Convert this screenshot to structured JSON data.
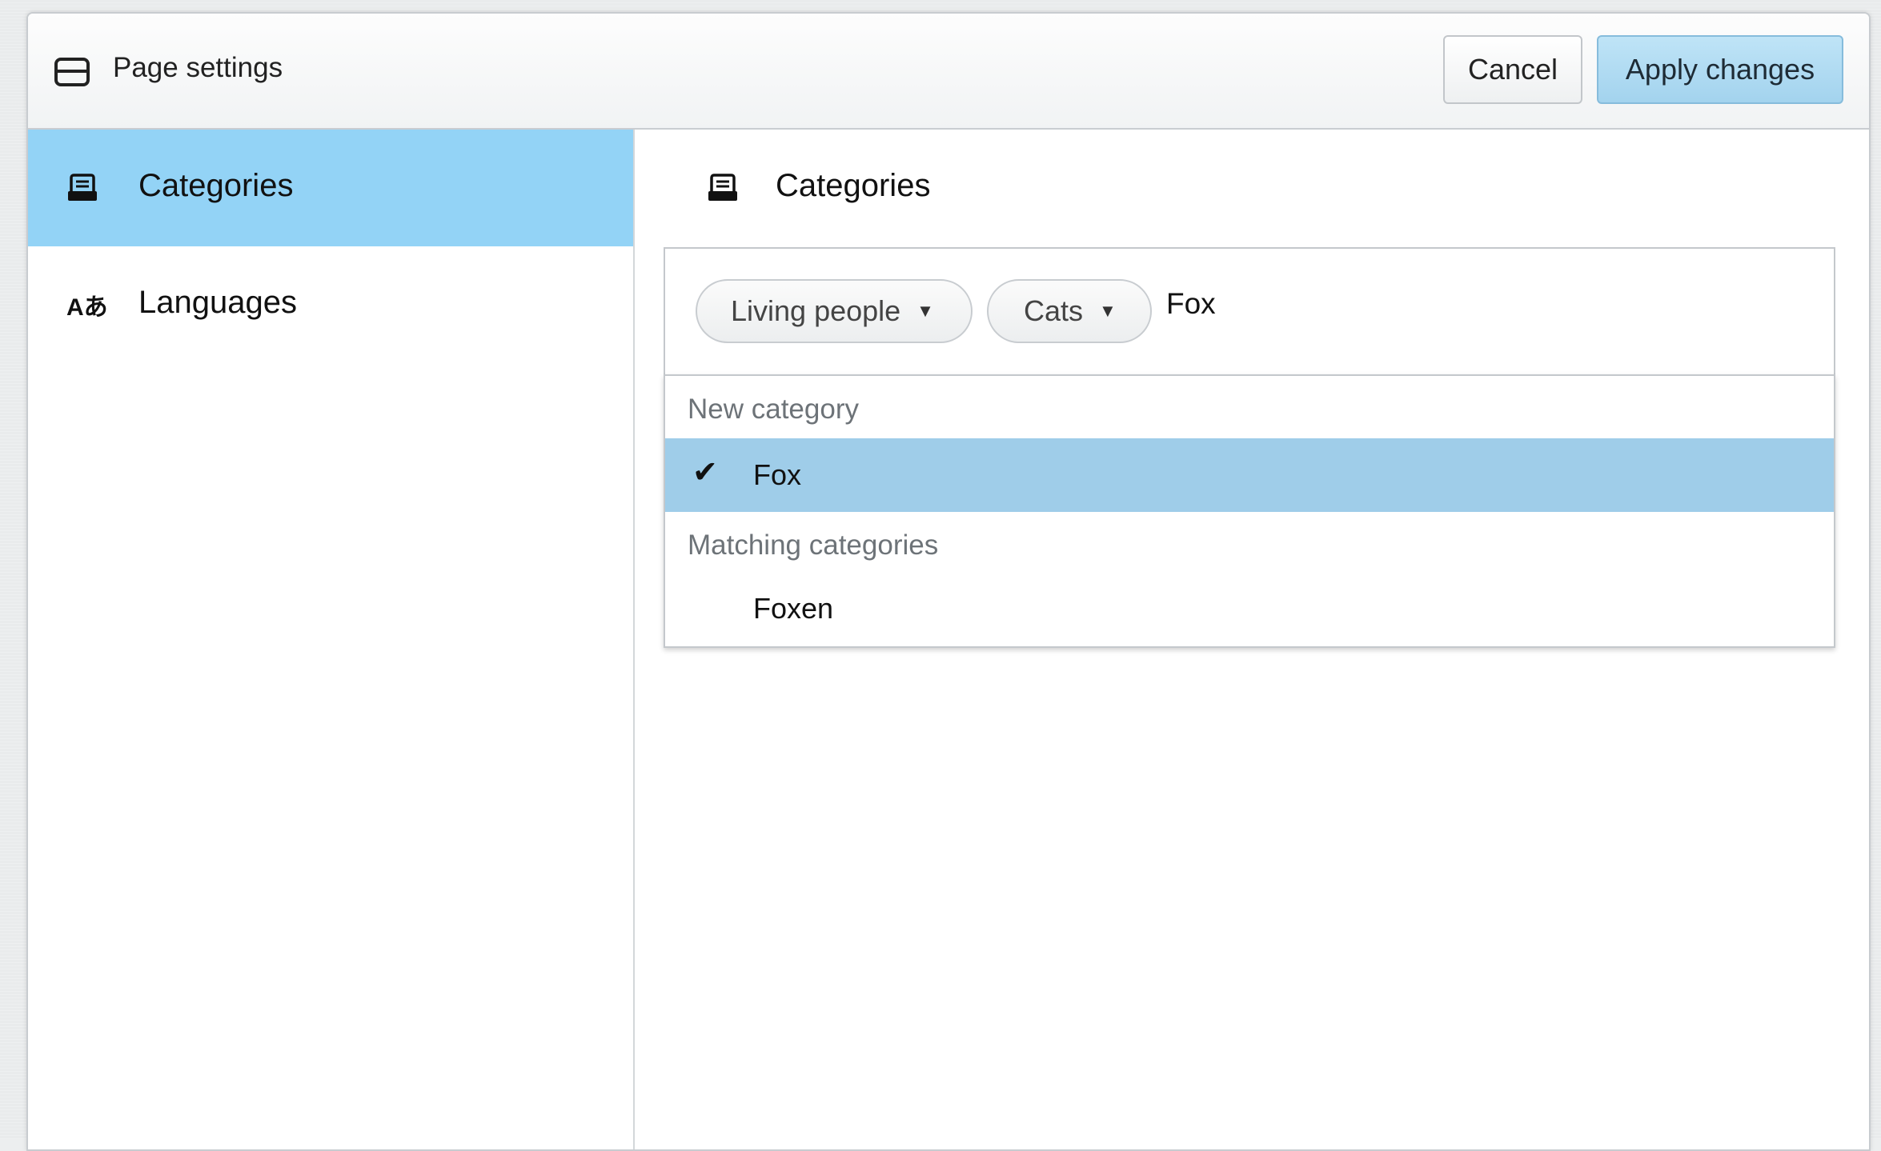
{
  "header": {
    "title": "Page settings",
    "cancel_label": "Cancel",
    "apply_label": "Apply changes",
    "icon": "page-icon"
  },
  "sidebar": {
    "items": [
      {
        "label": "Categories",
        "icon": "categories-icon",
        "active": true
      },
      {
        "label": "Languages",
        "icon": "languages-icon",
        "icon_text": "Aあ",
        "active": false
      }
    ]
  },
  "main": {
    "title": "Categories",
    "icon": "categories-icon",
    "selected_categories": [
      {
        "label": "Living people",
        "arrow": "▼"
      },
      {
        "label": "Cats",
        "arrow": "▼"
      }
    ],
    "input_value": "Fox",
    "dropdown": {
      "new_header": "New category",
      "new_option": {
        "label": "Fox",
        "check": "✔",
        "highlighted": true
      },
      "matching_header": "Matching categories",
      "matching_options": [
        {
          "label": "Foxen"
        }
      ]
    }
  },
  "colors": {
    "active_sidebar": "#93d3f6",
    "highlight_option": "#9fcde9",
    "apply_button": "#a3d3ee"
  }
}
